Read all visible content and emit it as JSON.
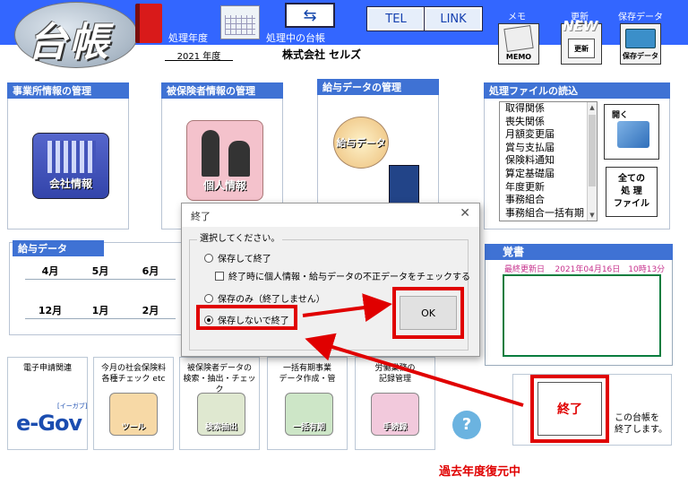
{
  "header": {
    "logo": "台帳",
    "fiscal_year_label": "処理年度",
    "current_ledger_label": "処理中の台帳",
    "fiscal_year": "2021 年度",
    "company_name": "株式会社 セルズ",
    "tel_button": "TEL",
    "link_button": "LINK",
    "memo_label": "メモ",
    "memo_icon_label": "MEMO",
    "update_label": "更新",
    "update_new": "NEW",
    "update_icon_label": "更新",
    "save_label": "保存データ",
    "save_icon_label": "保存データ"
  },
  "panels": {
    "office_title": "事業所情報の管理",
    "office_icon": "会社情報",
    "insured_title": "被保険者情報の管理",
    "insured_icon": "個人情報",
    "salary_title": "給与データの管理",
    "salary_icon": "給与データ"
  },
  "file_panel": {
    "title": "処理ファイルの読込",
    "items": [
      "取得関係",
      "喪失関係",
      "月額変更届",
      "賞与支払届",
      "保険料通知",
      "算定基礎届",
      "年度更新",
      "事務組合",
      "事務組合一括有期"
    ],
    "open_label": "開く",
    "all_files_lines": [
      "全ての",
      "処 理",
      "ファイル"
    ]
  },
  "salary_grid": {
    "title": "給与データ",
    "row1": [
      "4月",
      "5月",
      "6月"
    ],
    "row2": [
      "12月",
      "1月",
      "2月"
    ]
  },
  "memo": {
    "title": "覚書",
    "last_updated_label": "最終更新日",
    "last_updated_value": "2021年04月16日　10時13分"
  },
  "tiles": {
    "t1_line1": "電子申請関連",
    "egov": "e-Gov",
    "egov_sub": "[イーガブ]",
    "t2_line1": "今月の社会保険料",
    "t2_line2": "各種チェック etc",
    "t2_icon": "ツール",
    "t3_line1": "被保険者データの",
    "t3_line2": "検索・抽出・チェック",
    "t3_icon": "検索抽出",
    "t4_line1": "一括有期事業",
    "t4_line2": "データ作成・管",
    "t4_icon": "一括有期",
    "t5_line1": "労働業務の",
    "t5_line2": "記録管理",
    "t5_icon": "手続録",
    "help": "?"
  },
  "exit": {
    "button": "終了",
    "note_line1": "この台帳を",
    "note_line2": "終了します。",
    "restore_status": "過去年度復元中"
  },
  "dialog": {
    "title": "終了",
    "close": "✕",
    "prompt": "選択してください。",
    "opt_save_exit": "保存して終了",
    "opt_check": "終了時に個人情報・給与データの不正データをチェックする",
    "opt_save_only": "保存のみ（終了しません）",
    "opt_no_save": "保存しないで終了",
    "ok": "OK",
    "selected": "opt_no_save"
  },
  "colors": {
    "header_band": "#3366ff",
    "panel_title": "#3f72d4",
    "highlight": "#e00000",
    "memo_border": "#0a7d3f"
  }
}
